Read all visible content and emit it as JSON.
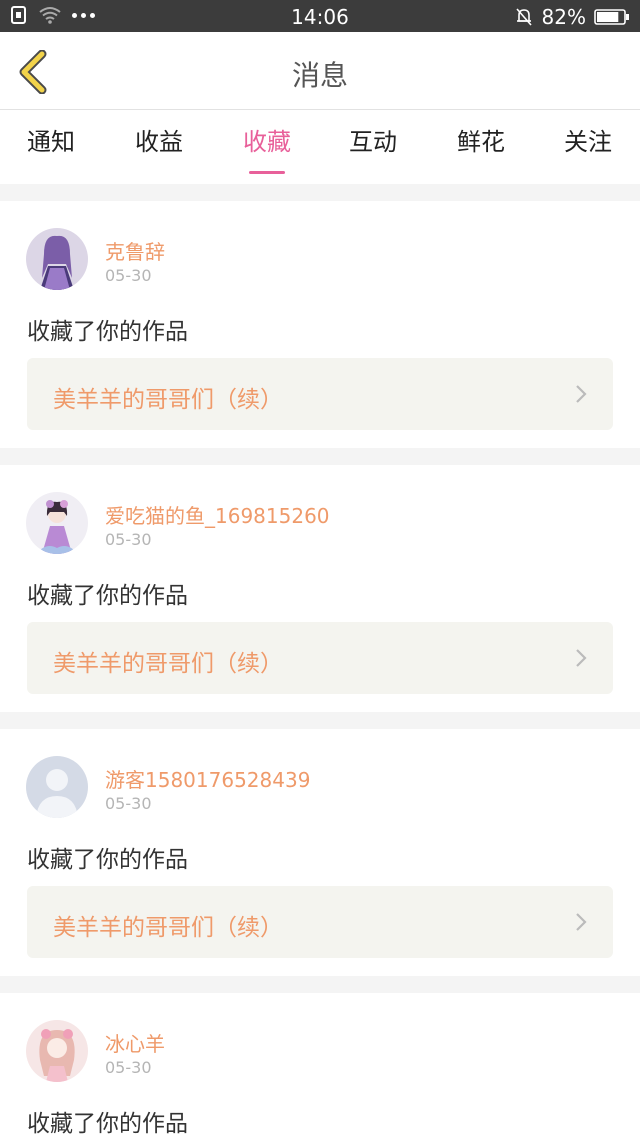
{
  "status_bar": {
    "time": "14:06",
    "battery": "82%",
    "battery_level": 0.82,
    "icons": [
      "sim-icon",
      "wifi-icon",
      "more-dots-icon",
      "mute-bell-icon",
      "battery-icon"
    ]
  },
  "header": {
    "title": "消息",
    "back_icon": "chevron-left-icon"
  },
  "tabs": [
    {
      "label": "通知",
      "active": false
    },
    {
      "label": "收益",
      "active": false
    },
    {
      "label": "收藏",
      "active": true
    },
    {
      "label": "互动",
      "active": false
    },
    {
      "label": "鲜花",
      "active": false
    },
    {
      "label": "关注",
      "active": false
    }
  ],
  "messages": [
    {
      "user": "克鲁辞",
      "date": "05-30",
      "action": "收藏了你的作品",
      "work": "美羊羊的哥哥们（续）",
      "avatar": "anime-avatar-purple"
    },
    {
      "user": "爱吃猫的鱼_169815260",
      "date": "05-30",
      "action": "收藏了你的作品",
      "work": "美羊羊的哥哥们（续）",
      "avatar": "anime-avatar-flower"
    },
    {
      "user": "游客1580176528439",
      "date": "05-30",
      "action": "收藏了你的作品",
      "work": "美羊羊的哥哥们（续）",
      "avatar": "default-person-avatar"
    },
    {
      "user": "冰心羊",
      "date": "05-30",
      "action": "收藏了你的作品",
      "work": "",
      "avatar": "anime-avatar-pink"
    }
  ],
  "colors": {
    "accent_pink": "#e8609a",
    "name_orange": "#ef9a6a",
    "back_arrow_yellow": "#f2d34a",
    "status_bar_bg": "#3c3c3c"
  }
}
